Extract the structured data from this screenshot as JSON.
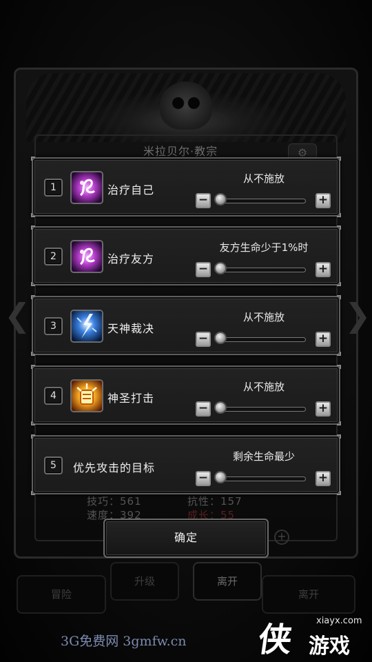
{
  "background": {
    "title": "米拉贝尔·教宗",
    "stats": {
      "skill": "技巧：561",
      "speed": "速度：392",
      "resist": "抗性：157",
      "growth": "成长：55"
    },
    "buttons": {
      "upgrade": "升级",
      "leave": "离开",
      "adventure": "冒险",
      "leave_far": "离开"
    }
  },
  "skills": [
    {
      "index": "1",
      "name": "治疗自己",
      "icon": "heal-self-icon",
      "condition": "从不施放",
      "slider_fraction": 0
    },
    {
      "index": "2",
      "name": "治疗友方",
      "icon": "heal-ally-icon",
      "condition": "友方生命少于1%时",
      "slider_fraction": 0
    },
    {
      "index": "3",
      "name": "天神裁决",
      "icon": "divine-judgment-icon",
      "condition": "从不施放",
      "slider_fraction": 0
    },
    {
      "index": "4",
      "name": "神圣打击",
      "icon": "holy-strike-icon",
      "condition": "从不施放",
      "slider_fraction": 0
    },
    {
      "index": "5",
      "name": "优先攻击的目标",
      "icon": null,
      "condition": "剩余生命最少",
      "slider_fraction": 0
    }
  ],
  "confirm_label": "确定",
  "watermarks": {
    "left": "3G免费网  3gmfw.cn",
    "logo_char": "侠",
    "logo_text": "游戏",
    "site": "xiayx.com"
  },
  "colors": {
    "panel_border": "#5e5e5e",
    "heal_icon": "#b23cc8",
    "judgment_icon": "#3a7fe0",
    "strike_icon": "#f0a020"
  }
}
